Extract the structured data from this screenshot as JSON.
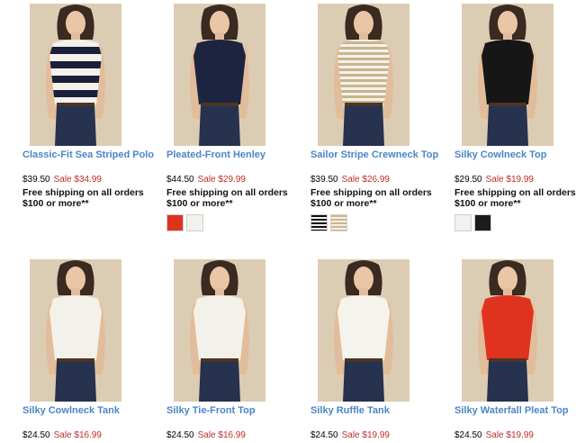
{
  "products": [
    {
      "name": "Classic-Fit Sea Striped Polo",
      "price": "$39.50",
      "sale": "Sale $34.99",
      "shipping": "Free shipping on all orders $100 or more**",
      "swatches": [],
      "top_color": "#1a1f3a",
      "top_style": "navy-white-stripes"
    },
    {
      "name": "Pleated-Front Henley",
      "price": "$44.50",
      "sale": "Sale $29.99",
      "shipping": "Free shipping on all orders $100 or more**",
      "swatches": [
        "#e0331f",
        "#f3f1ec"
      ],
      "top_color": "#1c2440",
      "top_style": "solid"
    },
    {
      "name": "Sailor Stripe Crewneck Top",
      "price": "$39.50",
      "sale": "Sale $26.99",
      "shipping": "Free shipping on all orders $100 or more**",
      "swatches": [
        "black-white-stripe",
        "tan-white-stripe"
      ],
      "top_color": "#d8c8a6",
      "top_style": "tan-white-stripes"
    },
    {
      "name": "Silky Cowlneck Top",
      "price": "$29.50",
      "sale": "Sale $19.99",
      "shipping": "Free shipping on all orders $100 or more**",
      "swatches": [
        "#f3f1ec",
        "#1c1c1c"
      ],
      "top_color": "#161616",
      "top_style": "solid"
    },
    {
      "name": "Silky Cowlneck Tank",
      "price": "$24.50",
      "sale": "Sale $16.99",
      "shipping": "",
      "swatches": [],
      "top_color": "#f4f1ea",
      "top_style": "solid"
    },
    {
      "name": "Silky Tie-Front Top",
      "price": "$24.50",
      "sale": "Sale $16.99",
      "shipping": "",
      "swatches": [],
      "top_color": "#f4f1ea",
      "top_style": "solid"
    },
    {
      "name": "Silky Ruffle Tank",
      "price": "$24.50",
      "sale": "Sale $19.99",
      "shipping": "",
      "swatches": [],
      "top_color": "#f6f3ec",
      "top_style": "solid"
    },
    {
      "name": "Silky Waterfall Pleat Top",
      "price": "$24.50",
      "sale": "Sale $19.99",
      "shipping": "",
      "swatches": [],
      "top_color": "#e0331f",
      "top_style": "solid"
    }
  ]
}
